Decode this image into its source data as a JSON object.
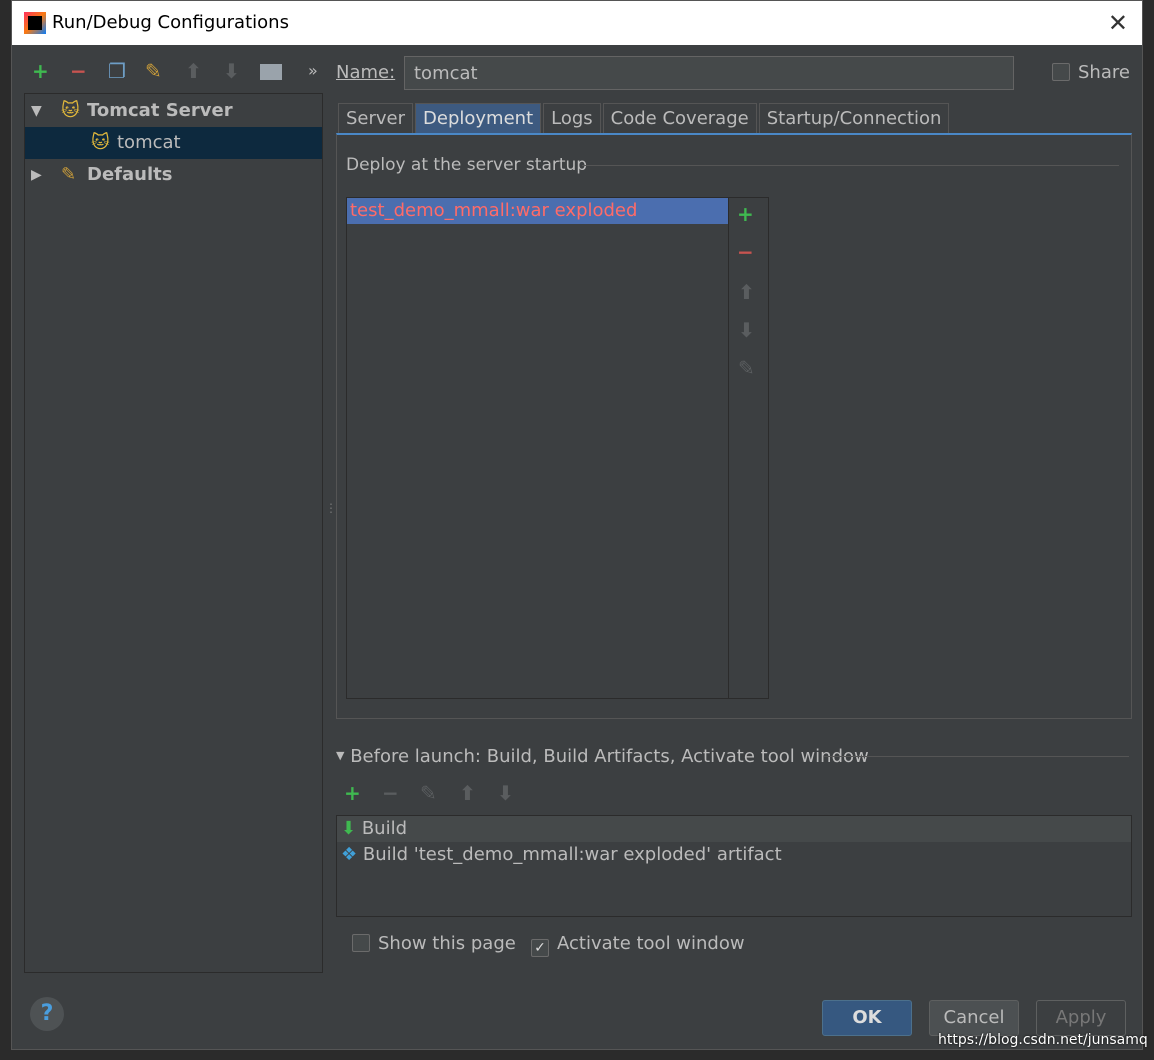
{
  "window": {
    "title": "Run/Debug Configurations"
  },
  "toolbar": {
    "more": "»"
  },
  "tree": {
    "items": [
      {
        "label": "Tomcat Server"
      },
      {
        "label": "tomcat"
      },
      {
        "label": "Defaults"
      }
    ]
  },
  "name": {
    "label": "Name:",
    "value": "tomcat"
  },
  "share": {
    "label": "Share",
    "checked": false
  },
  "tabs": [
    {
      "label": "Server"
    },
    {
      "label": "Deployment"
    },
    {
      "label": "Logs"
    },
    {
      "label": "Code Coverage"
    },
    {
      "label": "Startup/Connection"
    }
  ],
  "deployment": {
    "section": "Deploy at the server startup",
    "items": [
      "test_demo_mmall:war exploded"
    ]
  },
  "before_launch": {
    "title": "Before launch: Build, Build Artifacts, Activate tool window",
    "items": [
      "Build",
      "Build 'test_demo_mmall:war exploded' artifact"
    ]
  },
  "options": {
    "show_page": "Show this page",
    "show_page_checked": false,
    "activate": "Activate tool window",
    "activate_checked": true
  },
  "buttons": {
    "ok": "OK",
    "cancel": "Cancel",
    "apply": "Apply",
    "help": "?"
  },
  "watermark": "https://blog.csdn.net/junsamq",
  "colors": {
    "accent": "#4a88c7",
    "error_text": "#ff6b68",
    "add": "#3fb950",
    "remove": "#c75450",
    "selection": "#0d293e"
  }
}
